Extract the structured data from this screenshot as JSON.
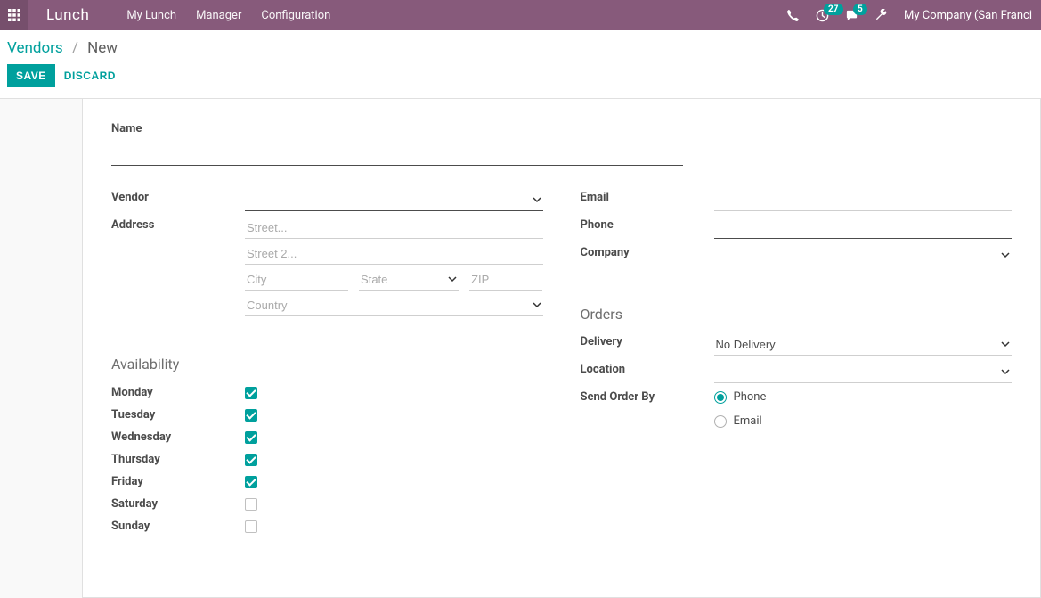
{
  "topbar": {
    "brand": "Lunch",
    "menu": [
      "My Lunch",
      "Manager",
      "Configuration"
    ],
    "activities_count": "27",
    "messages_count": "5",
    "company": "My Company (San Franci"
  },
  "breadcrumb": {
    "root": "Vendors",
    "current": "New"
  },
  "buttons": {
    "save": "SAVE",
    "discard": "DISCARD"
  },
  "labels": {
    "name": "Name",
    "vendor": "Vendor",
    "address": "Address",
    "email": "Email",
    "phone": "Phone",
    "company": "Company",
    "availability": "Availability",
    "orders": "Orders",
    "delivery": "Delivery",
    "location": "Location",
    "send_order_by": "Send Order By"
  },
  "placeholders": {
    "street": "Street...",
    "street2": "Street 2...",
    "city": "City",
    "state": "State",
    "zip": "ZIP",
    "country": "Country"
  },
  "availability": {
    "days": [
      {
        "label": "Monday",
        "checked": true
      },
      {
        "label": "Tuesday",
        "checked": true
      },
      {
        "label": "Wednesday",
        "checked": true
      },
      {
        "label": "Thursday",
        "checked": true
      },
      {
        "label": "Friday",
        "checked": true
      },
      {
        "label": "Saturday",
        "checked": false
      },
      {
        "label": "Sunday",
        "checked": false
      }
    ]
  },
  "orders": {
    "delivery_value": "No Delivery",
    "location_value": "",
    "send_order_by": [
      {
        "label": "Phone",
        "checked": true
      },
      {
        "label": "Email",
        "checked": false
      }
    ]
  }
}
